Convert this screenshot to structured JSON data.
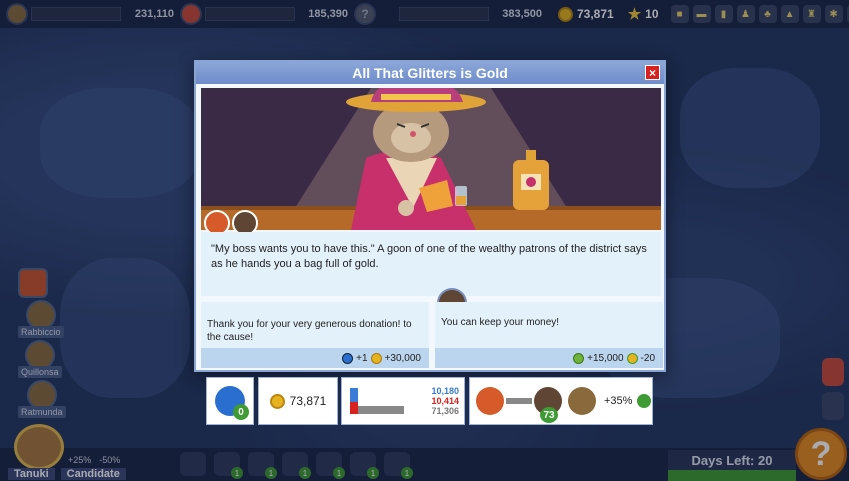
{
  "topbar": {
    "candidates": [
      {
        "value": "231,110",
        "fill": 0.0,
        "color": "#c94a3a",
        "face": "bear-candidate-icon"
      },
      {
        "value": "185,390",
        "fill": 0.0,
        "color": "#c94a3a",
        "face": "lion-candidate-icon"
      },
      {
        "value": "383,500",
        "fill": 0.0,
        "color": "#3a7bd5",
        "face": "unknown-candidate-icon",
        "glyph": "?"
      }
    ],
    "coins": "73,871",
    "stars": "10"
  },
  "modal": {
    "title": "All That Glitters is Gold",
    "close": "×",
    "story": "\"My boss wants you to have this.\" A goon of one of the wealthy patrons of the district says as he hands you a bag full of gold.",
    "choices": [
      {
        "text": "Thank you for your very generous donation! to the cause!",
        "effect_a": "+1",
        "effect_b": "+30,000"
      },
      {
        "text": "You can keep your money!",
        "effect_a": "+15,000",
        "effect_b": "-20"
      }
    ]
  },
  "stats": {
    "bomb_count": "0",
    "coins": "73,871",
    "poll": {
      "blue": "10,180",
      "red": "10,414",
      "grey": "71,306"
    },
    "relation_level": "73",
    "relation_bonus": "+35%"
  },
  "side_candidates": [
    "Rabbiccio",
    "Quillonsa",
    "Ratmunda"
  ],
  "player": {
    "name": "Tanuki",
    "role": "Candidate",
    "mod_a": "+25%",
    "mod_b": "-50%"
  },
  "actions": [
    {
      "badge": ""
    },
    {
      "badge": "1"
    },
    {
      "badge": "1"
    },
    {
      "badge": "1"
    },
    {
      "badge": "1"
    },
    {
      "badge": "1"
    },
    {
      "badge": "1"
    }
  ],
  "days_left_label": "Days Left: 20",
  "help": "?",
  "colors": {
    "title_bar": "#7893cf",
    "close": "#d8201e",
    "coin": "#e6b21e",
    "green": "#3f9b33",
    "help": "#e58a1e"
  }
}
